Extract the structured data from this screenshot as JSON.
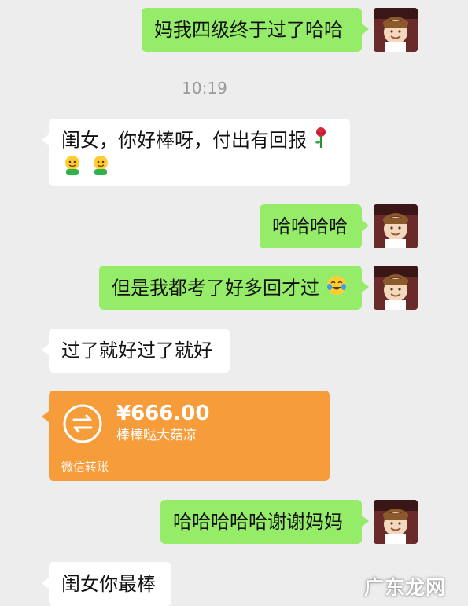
{
  "conversation": {
    "time": "10:19",
    "messages": [
      {
        "id": "m1",
        "from": "me",
        "text": "妈我四级终于过了哈哈"
      },
      {
        "id": "m2",
        "from": "mom",
        "text": "闺女，你好棒呀，付出有回报",
        "emojis": [
          "rose-emoji",
          "smile-emoji",
          "smile-emoji"
        ]
      },
      {
        "id": "m3",
        "from": "me",
        "text": "哈哈哈哈"
      },
      {
        "id": "m4",
        "from": "me",
        "text": "但是我都考了好多回才过",
        "emojis": [
          "laugh-tears-emoji"
        ]
      },
      {
        "id": "m5",
        "from": "mom",
        "text": "过了就好过了就好"
      },
      {
        "id": "m6",
        "from": "me",
        "text": "哈哈哈哈哈谢谢妈妈"
      },
      {
        "id": "m7",
        "from": "mom",
        "text": "闺女你最棒"
      }
    ],
    "transfer": {
      "amount": "¥666.00",
      "note": "棒棒哒大菇凉",
      "label": "微信转账",
      "icon": "transfer-arrows-icon",
      "color": "#f79c3a"
    }
  },
  "watermark": {
    "text": "广东龙网"
  },
  "colors": {
    "background": "#ededed",
    "out_bubble": "#95ec69",
    "in_bubble": "#ffffff"
  }
}
